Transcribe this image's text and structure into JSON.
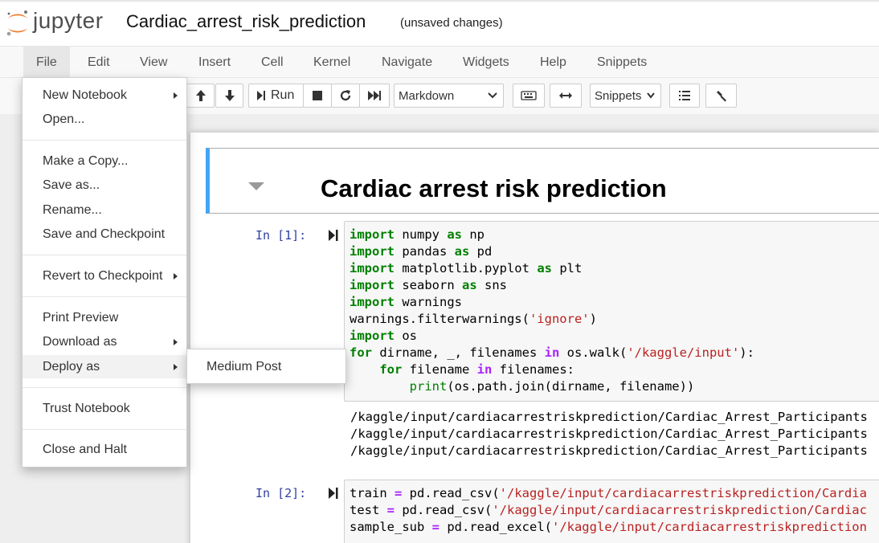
{
  "header": {
    "logo_text": "jupyter",
    "notebook_name": "Cardiac_arrest_risk_prediction",
    "save_status": "(unsaved changes)"
  },
  "menubar": [
    "File",
    "Edit",
    "View",
    "Insert",
    "Cell",
    "Kernel",
    "Navigate",
    "Widgets",
    "Help",
    "Snippets"
  ],
  "toolbar": {
    "run_label": "Run",
    "cell_type": "Markdown",
    "snippets": "Snippets"
  },
  "file_menu": {
    "items": [
      "New Notebook",
      "Open...",
      "Make a Copy...",
      "Save as...",
      "Rename...",
      "Save and Checkpoint",
      "Revert to Checkpoint",
      "Print Preview",
      "Download as",
      "Deploy as",
      "Trust Notebook",
      "Close and Halt"
    ],
    "submenu": [
      "Medium Post"
    ]
  },
  "notebook": {
    "heading": "Cardiac arrest risk prediction",
    "cell1_prompt": "In [1]:",
    "cell2_prompt": "In [2]:",
    "cell1_code": [
      "import numpy as np",
      "import pandas as pd",
      "import matplotlib.pyplot as plt",
      "import seaborn as sns",
      "import warnings",
      "warnings.filterwarnings('ignore')",
      "import os",
      "for dirname, _, filenames in os.walk('/kaggle/input'):",
      "    for filename in filenames:",
      "        print(os.path.join(dirname, filename))"
    ],
    "cell1_output": [
      "/kaggle/input/cardiacarrestriskprediction/Cardiac_Arrest_Participants",
      "/kaggle/input/cardiacarrestriskprediction/Cardiac_Arrest_Participants",
      "/kaggle/input/cardiacarrestriskprediction/Cardiac_Arrest_Participants"
    ],
    "cell2_code": [
      "train = pd.read_csv('/kaggle/input/cardiacarrestriskprediction/Cardia",
      "test = pd.read_csv('/kaggle/input/cardiacarrestriskprediction/Cardiac",
      "sample_sub = pd.read_excel('/kaggle/input/cardiacarrestriskprediction"
    ]
  },
  "colors": {
    "selected_cell_border": "#42a5f5",
    "keyword": "#008000",
    "string": "#ba2121",
    "prompt": "#303f9f"
  }
}
